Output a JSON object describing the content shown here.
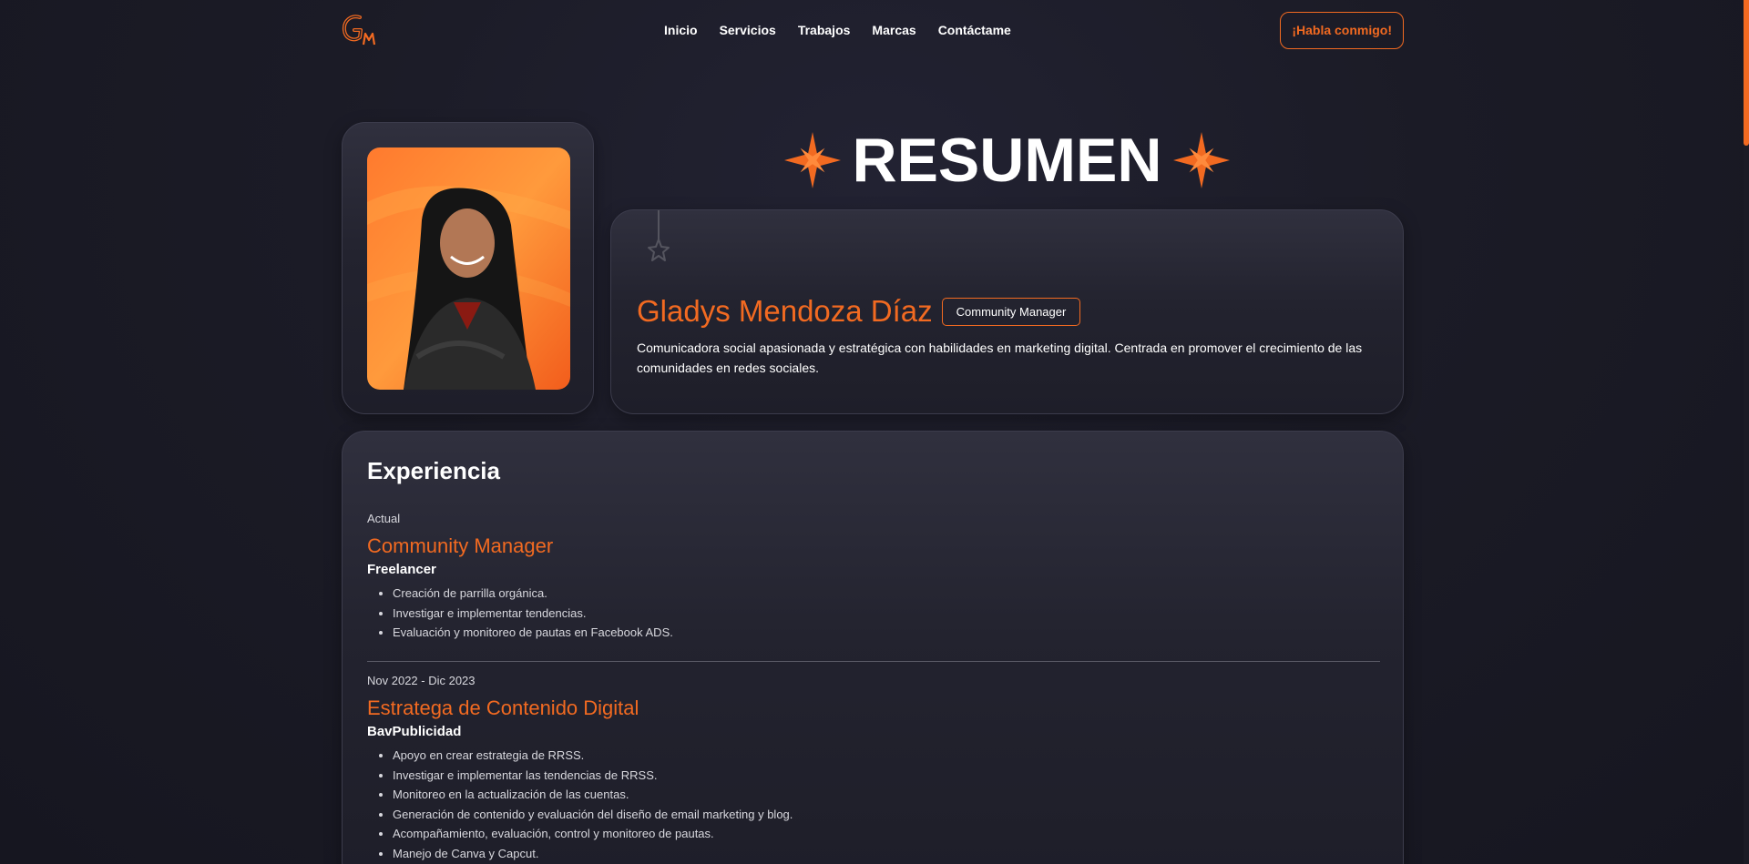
{
  "header": {
    "logo_text": "GM",
    "nav": [
      "Inicio",
      "Servicios",
      "Trabajos",
      "Marcas",
      "Contáctame"
    ],
    "cta_label": "¡Habla conmigo!"
  },
  "summary": {
    "section_title": "RESUMEN",
    "name": "Gladys Mendoza Díaz",
    "role_badge": "Community Manager",
    "bio": "Comunicadora social apasionada y estratégica con habilidades en marketing digital. Centrada en promover el crecimiento de las comunidades en redes sociales."
  },
  "experience": {
    "title": "Experiencia",
    "jobs": [
      {
        "date": "Actual",
        "role": "Community Manager",
        "company": "Freelancer",
        "tasks": [
          "Creación de parrilla orgánica.",
          "Investigar e implementar tendencias.",
          "Evaluación y monitoreo de pautas en Facebook ADS."
        ]
      },
      {
        "date": "Nov 2022 - Dic 2023",
        "role": "Estratega de Contenido Digital",
        "company": "BavPublicidad",
        "tasks": [
          "Apoyo en crear estrategia de RRSS.",
          "Investigar e implementar las tendencias de RRSS.",
          "Monitoreo en la actualización de las cuentas.",
          "Generación de contenido y evaluación del diseño de email marketing y blog.",
          "Acompañamiento, evaluación, control y monitoreo de pautas.",
          "Manejo de Canva y Capcut."
        ]
      }
    ]
  },
  "colors": {
    "accent": "#f26a21",
    "background": "#1b1b25",
    "card": "#2a2a37"
  }
}
